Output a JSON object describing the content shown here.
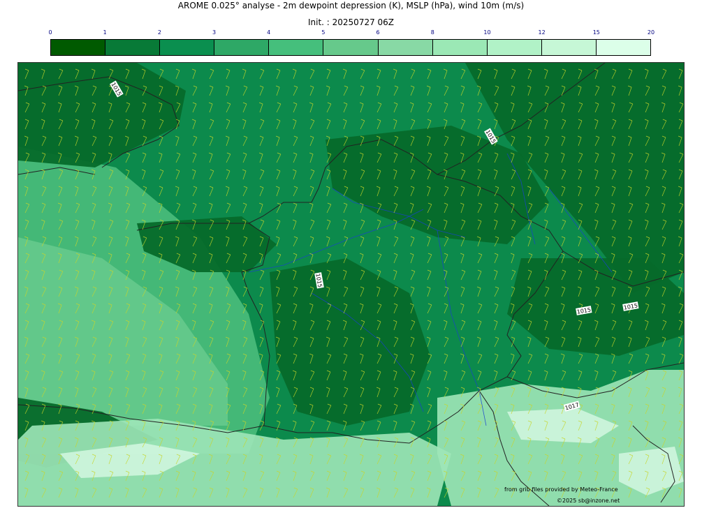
{
  "title": "AROME 0.025° analyse - 2m dewpoint depression (K), MSLP (hPa), wind 10m (m/s)",
  "init": "Init. : 20250727 06Z",
  "colorbar": {
    "ticks": [
      "0",
      "1",
      "2",
      "3",
      "4",
      "5",
      "6",
      "8",
      "10",
      "12",
      "15",
      "20"
    ],
    "colors": [
      "#005a00",
      "#087a37",
      "#0a8f4f",
      "#2ea866",
      "#45bf7c",
      "#66c98b",
      "#88d9a5",
      "#9be8b5",
      "#b1f2c7",
      "#c6f7d6",
      "#dcffe9"
    ]
  },
  "map": {
    "land_colors": {
      "dark": "#066a2a",
      "mid": "#0c8a4c",
      "light": "#4fbf7f",
      "pale": "#9fe6b8",
      "very_pale": "#d4f7e0"
    },
    "border_color": "#222222",
    "river_color": "#1a3fd0",
    "wind_barb_color": "#c8d62a",
    "isobar_labels": [
      "1015",
      "1015",
      "1015",
      "1015",
      "1015",
      "1017"
    ]
  },
  "credits": {
    "provider": "from grib files provided by Meteo-France",
    "copyright": "©2025 sb@inzone.net"
  }
}
